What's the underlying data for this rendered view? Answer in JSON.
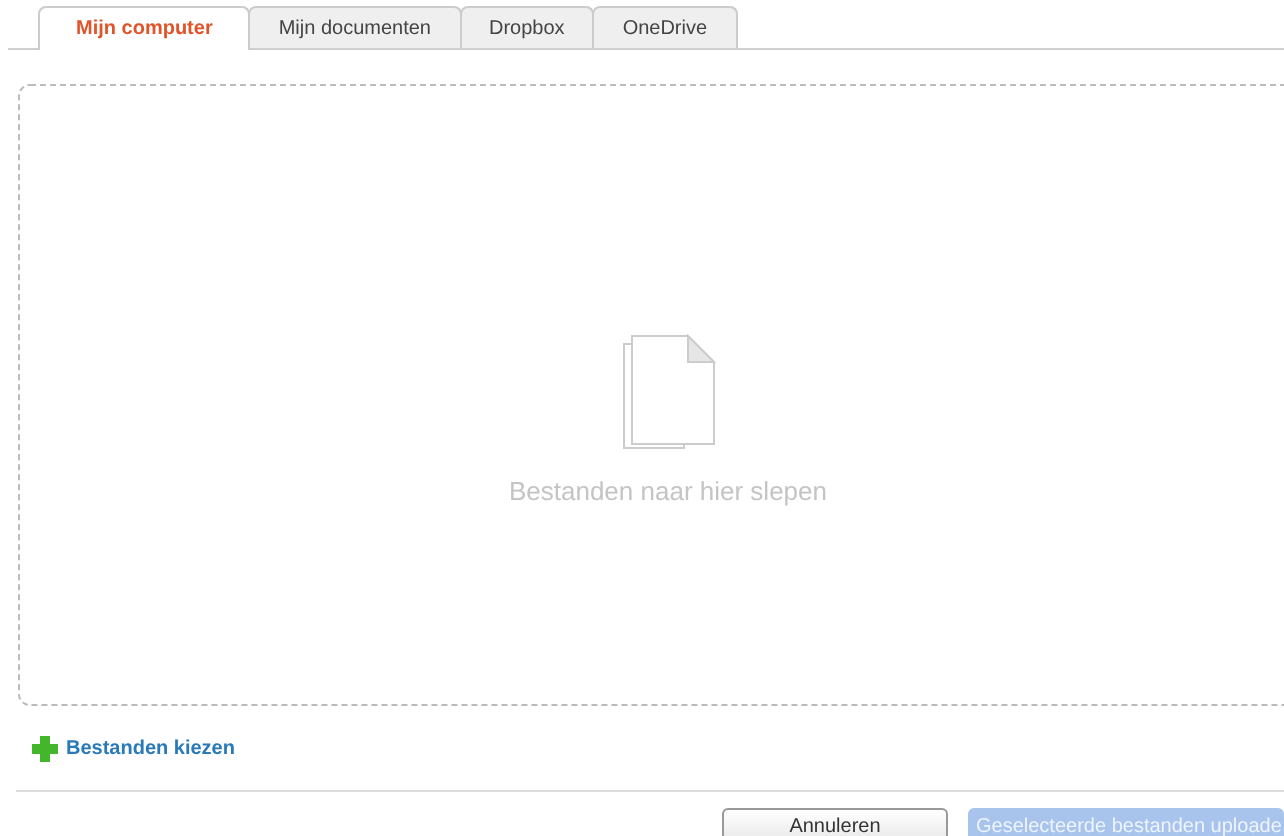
{
  "tabs": [
    {
      "label": "Mijn computer",
      "selected": true
    },
    {
      "label": "Mijn documenten",
      "selected": false
    },
    {
      "label": "Dropbox",
      "selected": false
    },
    {
      "label": "OneDrive",
      "selected": false
    }
  ],
  "dropzone": {
    "hint": "Bestanden naar hier slepen"
  },
  "choose_link": "Bestanden kiezen",
  "buttons": [
    {
      "label": "Annuleren",
      "disabled": false
    },
    {
      "label": "Geselecteerde bestanden uploade",
      "disabled": true
    }
  ]
}
